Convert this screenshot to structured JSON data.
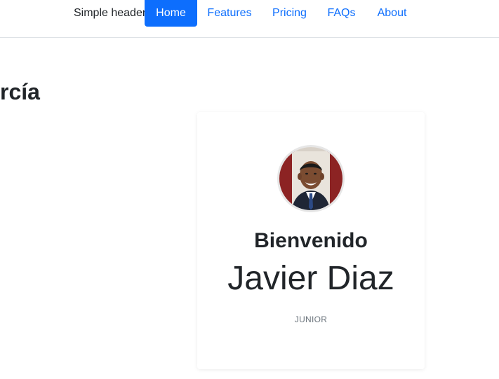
{
  "navbar": {
    "brand": "Simple header",
    "items": [
      {
        "label": "Home",
        "active": true
      },
      {
        "label": "Features",
        "active": false
      },
      {
        "label": "Pricing",
        "active": false
      },
      {
        "label": "FAQs",
        "active": false
      },
      {
        "label": "About",
        "active": false
      }
    ]
  },
  "main": {
    "heading_fragment": "rcía"
  },
  "profile_card": {
    "avatar_icon": "user-avatar-photo",
    "welcome": "Bienvenido",
    "name": "Javier Diaz",
    "role": "JUNIOR"
  },
  "colors": {
    "accent": "#0d6efd",
    "text": "#212529",
    "muted": "#6c757d"
  }
}
